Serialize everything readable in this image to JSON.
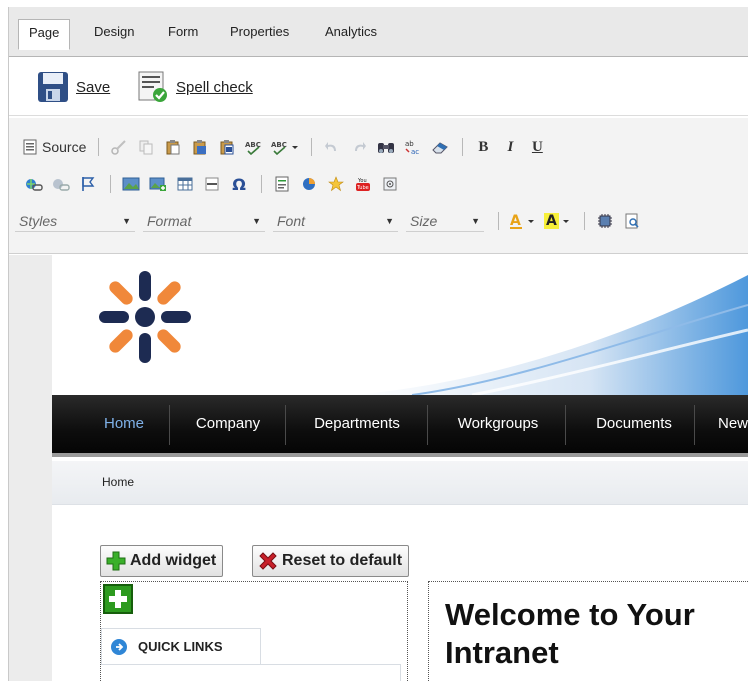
{
  "tabs": [
    {
      "label": "Page",
      "active": true
    },
    {
      "label": "Design",
      "active": false
    },
    {
      "label": "Form",
      "active": false
    },
    {
      "label": "Properties",
      "active": false
    },
    {
      "label": "Analytics",
      "active": false
    }
  ],
  "actions": {
    "save_label": "Save",
    "spellcheck_label": "Spell check"
  },
  "toolbar": {
    "source_label": "Source",
    "bold_label": "B",
    "italic_label": "I",
    "underline_label": "U",
    "omega_label": "Ω",
    "styles_placeholder": "Styles",
    "format_placeholder": "Format",
    "font_placeholder": "Font",
    "size_placeholder": "Size",
    "text_color_label": "A",
    "bg_color_label": "A",
    "spell_abc": "ABC",
    "youtube_top": "You",
    "youtube_bottom": "Tube"
  },
  "site": {
    "nav": [
      {
        "label": "Home",
        "active": true
      },
      {
        "label": "Company",
        "active": false
      },
      {
        "label": "Departments",
        "active": false
      },
      {
        "label": "Workgroups",
        "active": false
      },
      {
        "label": "Documents",
        "active": false
      },
      {
        "label": "New",
        "active": false
      }
    ],
    "breadcrumb": "Home",
    "add_widget_label": "Add widget",
    "reset_label": "Reset to default",
    "quick_links_label": "QUICK LINKS",
    "welcome_line1": "Welcome to Your",
    "welcome_line2": "Intranet"
  },
  "colors": {
    "nav_active": "#7fb1e8",
    "logo_navy": "#1d2b52",
    "logo_orange": "#f0883a",
    "add_green": "#2d9a1f",
    "reset_red": "#c8202a",
    "quicklinks_blue": "#2f86d6"
  }
}
